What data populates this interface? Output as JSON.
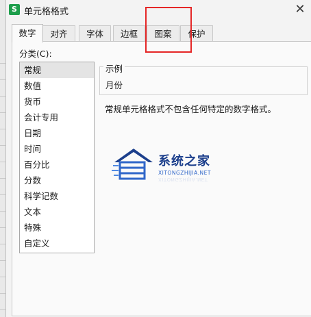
{
  "window": {
    "title": "单元格格式",
    "close_glyph": "✕",
    "app_icon_letter": "S"
  },
  "tabs": [
    {
      "label": "数字",
      "active": true
    },
    {
      "label": "对齐",
      "active": false
    },
    {
      "label": "字体",
      "active": false
    },
    {
      "label": "边框",
      "active": false
    },
    {
      "label": "图案",
      "active": false
    },
    {
      "label": "保护",
      "active": false
    }
  ],
  "category": {
    "label": "分类(C):",
    "items": [
      "常规",
      "数值",
      "货币",
      "会计专用",
      "日期",
      "时间",
      "百分比",
      "分数",
      "科学记数",
      "文本",
      "特殊",
      "自定义"
    ],
    "selected": "常规"
  },
  "sample": {
    "title": "示例",
    "value": "月份"
  },
  "description": "常规单元格格式不包含任何特定的数字格式。",
  "watermark": {
    "name": "系统之家",
    "domain": "XITONGZHIJIA.NET"
  },
  "annotation": {
    "color": "#e52626",
    "target_tab": "图案"
  },
  "colors": {
    "brand_green": "#1d9e4b",
    "watermark_blue": "#1c3f8c"
  }
}
